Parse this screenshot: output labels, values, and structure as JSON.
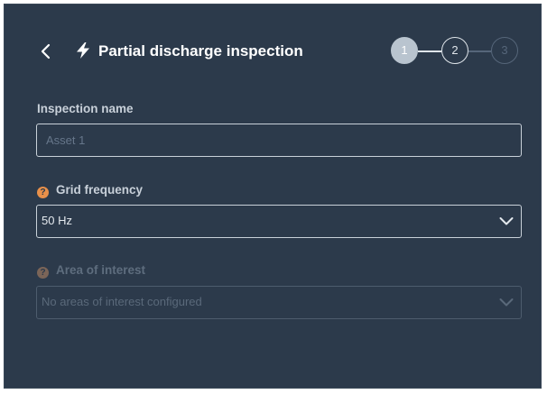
{
  "header": {
    "back_icon": "chevron-left-icon",
    "title_icon": "lightning-bolt-icon",
    "title": "Partial discharge inspection",
    "steps": [
      {
        "label": "1",
        "state": "active"
      },
      {
        "label": "2",
        "state": "upcoming"
      },
      {
        "label": "3",
        "state": "disabled"
      }
    ]
  },
  "form": {
    "inspection_name": {
      "label": "Inspection name",
      "value": "",
      "placeholder": "Asset 1"
    },
    "grid_frequency": {
      "help_icon": "question-circle-icon",
      "label": "Grid frequency",
      "value": "50 Hz"
    },
    "area_of_interest": {
      "help_icon": "question-circle-icon",
      "label": "Area of interest",
      "value": "No areas of interest configured",
      "disabled": true
    }
  },
  "colors": {
    "panel_bg": "#2c3a4b",
    "accent_help": "#e8904a",
    "text_primary": "#ffffff"
  }
}
